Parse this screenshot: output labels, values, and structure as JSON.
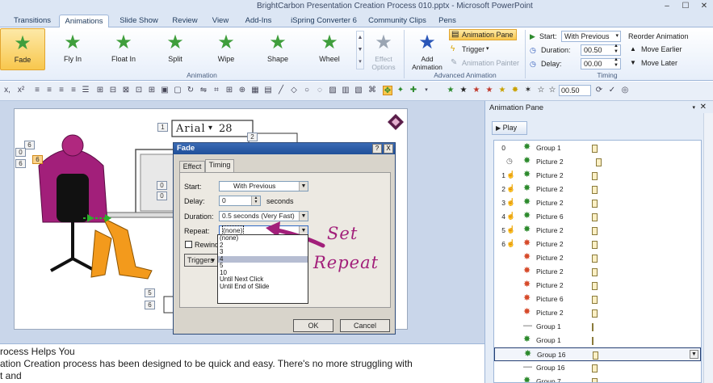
{
  "window": {
    "title": "BrightCarbon Presentation Creation Process 010.pptx - Microsoft PowerPoint"
  },
  "tabs": [
    "Transitions",
    "Animations",
    "Slide Show",
    "Review",
    "View",
    "Add-Ins",
    "iSpring Converter 6",
    "Community Clips",
    "Pens"
  ],
  "ribbon": {
    "effects": [
      "Fade",
      "Fly In",
      "Float In",
      "Split",
      "Wipe",
      "Shape",
      "Wheel"
    ],
    "effect_options": "Effect Options",
    "animation_group_label": "Animation",
    "add_animation": "Add Animation",
    "animation_pane": "Animation Pane",
    "trigger": "Trigger",
    "animation_painter": "Animation Painter",
    "advanced_group_label": "Advanced Animation",
    "start_label": "Start:",
    "start_value": "With Previous",
    "duration_label": "Duration:",
    "duration_value": "00.50",
    "delay_label": "Delay:",
    "delay_value": "00.00",
    "reorder": "Reorder Animation",
    "move_earlier": "Move Earlier",
    "move_later": "Move Later",
    "timing_group_label": "Timing"
  },
  "toolbar": {
    "zoom_value": "00.50"
  },
  "slide": {
    "font_name": "Arial",
    "font_size": "28",
    "badges": [
      "1",
      "2",
      "6",
      "0",
      "6",
      "6",
      "0",
      "0",
      "5",
      "6"
    ]
  },
  "dialog": {
    "title": "Fade",
    "help": "?",
    "close": "X",
    "tab_effect": "Effect",
    "tab_timing": "Timing",
    "start_label": "Start:",
    "start_value": "With Previous",
    "delay_label": "Delay:",
    "delay_value": "0",
    "seconds": "seconds",
    "duration_label": "Duration:",
    "duration_value": "0.5 seconds (Very Fast)",
    "repeat_label": "Repeat:",
    "repeat_value": "(none)",
    "rewind_label": "Rewind",
    "triggers_label": "Triggers",
    "repeat_options": [
      "(none)",
      "2",
      "3",
      "4",
      "5",
      "10",
      "Until Next Click",
      "Until End of Slide"
    ],
    "ok": "OK",
    "cancel": "Cancel"
  },
  "annotation": {
    "line1": "Set",
    "line2": "Repeat"
  },
  "pane": {
    "title": "Animation Pane",
    "play": "Play",
    "items": [
      {
        "num": "0",
        "trig": "",
        "name": "Group 1",
        "color": "#2d8a2d"
      },
      {
        "num": "",
        "trig": "◷",
        "name": "Picture 2",
        "color": "#2d8a2d"
      },
      {
        "num": "1",
        "trig": "☝",
        "name": "Picture 2",
        "color": "#2d8a2d"
      },
      {
        "num": "2",
        "trig": "☝",
        "name": "Picture 2",
        "color": "#2d8a2d"
      },
      {
        "num": "3",
        "trig": "☝",
        "name": "Picture 2",
        "color": "#2d8a2d"
      },
      {
        "num": "4",
        "trig": "☝",
        "name": "Picture 6",
        "color": "#2d8a2d"
      },
      {
        "num": "5",
        "trig": "☝",
        "name": "Picture 2",
        "color": "#2d8a2d"
      },
      {
        "num": "6",
        "trig": "☝",
        "name": "Picture 2",
        "color": "#d64a2a"
      },
      {
        "num": "",
        "trig": "",
        "name": "Picture 2",
        "color": "#d64a2a"
      },
      {
        "num": "",
        "trig": "",
        "name": "Picture 2",
        "color": "#d64a2a"
      },
      {
        "num": "",
        "trig": "",
        "name": "Picture 2",
        "color": "#d64a2a"
      },
      {
        "num": "",
        "trig": "",
        "name": "Picture 6",
        "color": "#d64a2a"
      },
      {
        "num": "",
        "trig": "",
        "name": "Picture 2",
        "color": "#d64a2a"
      },
      {
        "num": "",
        "trig": "",
        "name": "Group 1",
        "color": "#555555"
      },
      {
        "num": "",
        "trig": "",
        "name": "Group 1",
        "color": "#2d8a2d"
      },
      {
        "num": "",
        "trig": "",
        "name": "Group 16",
        "color": "#2d8a2d"
      },
      {
        "num": "",
        "trig": "",
        "name": "Group 16",
        "color": "#555555"
      },
      {
        "num": "",
        "trig": "",
        "name": "Group 7",
        "color": "#2d8a2d"
      }
    ]
  },
  "notes": {
    "line1": "rocess Helps You",
    "line2": "ation Creation process has been designed to be quick and easy. There's no more struggling with",
    "line3": "t and"
  },
  "colors": {
    "accent": "#a21f7a",
    "ribbon_bg": "#dce6f4"
  }
}
